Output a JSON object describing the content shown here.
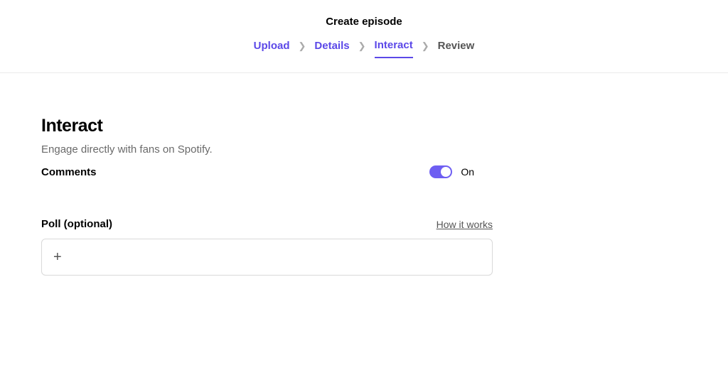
{
  "header": {
    "title": "Create episode",
    "steps": [
      "Upload",
      "Details",
      "Interact",
      "Review"
    ],
    "active_index": 2
  },
  "main": {
    "section_title": "Interact",
    "section_subtitle": "Engage directly with fans on Spotify.",
    "comments": {
      "label": "Comments",
      "toggle_state": "On"
    },
    "poll": {
      "label": "Poll (optional)",
      "help_link": "How it works"
    }
  }
}
